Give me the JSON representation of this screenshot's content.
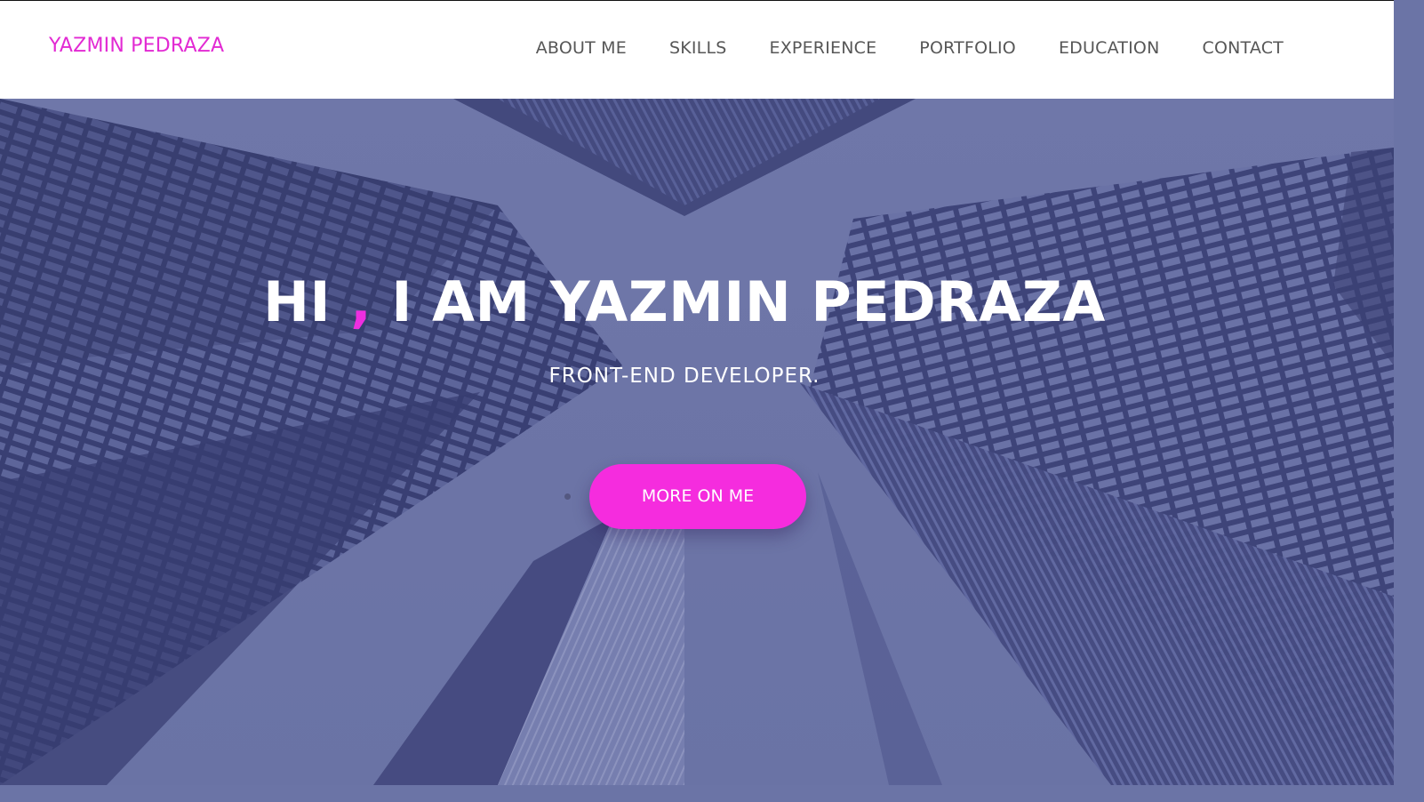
{
  "brand": {
    "name": "YAZMIN PEDRAZA",
    "color": "#e22ad3"
  },
  "nav": {
    "items": [
      {
        "label": "ABOUT ME"
      },
      {
        "label": "SKILLS"
      },
      {
        "label": "EXPERIENCE"
      },
      {
        "label": "PORTFOLIO"
      },
      {
        "label": "EDUCATION"
      },
      {
        "label": "CONTACT"
      }
    ]
  },
  "hero": {
    "title_start": "HI ",
    "title_comma": ",",
    "title_end": " I AM YAZMIN PEDRAZA",
    "subtitle": "FRONT-END DEVELOPER.",
    "button_label": "MORE ON ME",
    "accent_color": "#f52cde",
    "overlay_color": "#6d76a8"
  }
}
